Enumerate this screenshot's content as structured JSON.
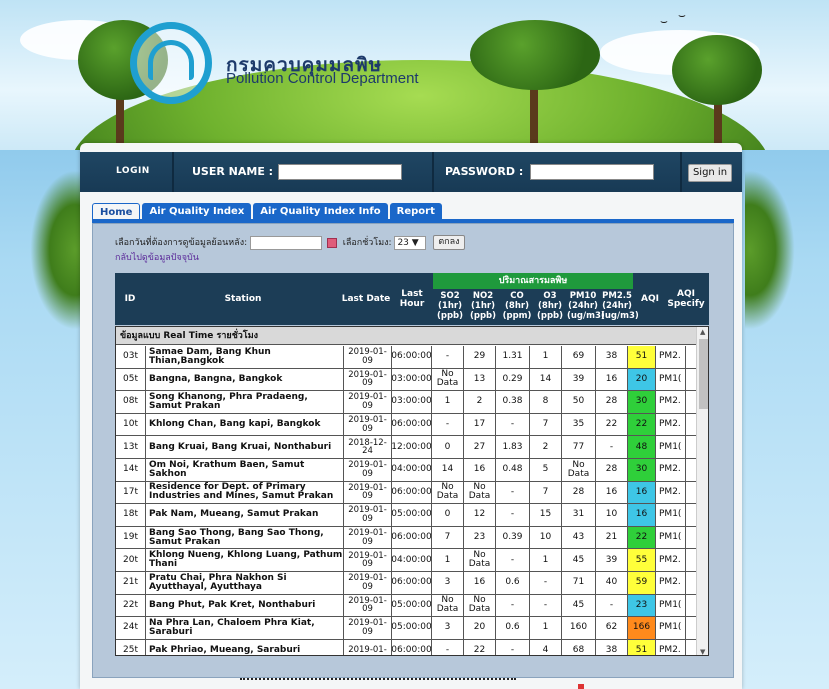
{
  "header": {
    "org_thai": "กรมควบคุมมลพิษ",
    "org_english": "Pollution Control Department"
  },
  "login": {
    "login_label": "LOGIN",
    "username_label": "USER NAME :",
    "username_value": "",
    "password_label": "PASSWORD :",
    "password_value": "",
    "signin_label": "Sign in"
  },
  "tabs": [
    {
      "label": "Home",
      "active": true
    },
    {
      "label": "Air Quality Index",
      "active": false
    },
    {
      "label": "Air Quality Index Info",
      "active": false
    },
    {
      "label": "Report",
      "active": false
    }
  ],
  "filter": {
    "date_label": "เลือกวันที่ต้องการดูข้อมูลย้อนหลัง:",
    "date_value": "",
    "hour_label": "เลือกชั่วโมง:",
    "hour_value": "23 ▼",
    "ok_label": "ตกลง",
    "back_link": "กลับไปดูข้อมูลปัจจุบัน"
  },
  "table": {
    "headers": {
      "id": "ID",
      "station": "Station",
      "last_date": "Last Date",
      "last_hour": "Last Hour",
      "pollutant_group": "ปริมาณสารมลพิษ",
      "so2": "SO2 (1hr) (ppb)",
      "no2": "NO2 (1hr) (ppb)",
      "co": "CO (8hr) (ppm)",
      "o3": "O3 (8hr) (ppb)",
      "pm10": "PM10 (24hr) (ug/m3)",
      "pm25": "PM2.5 (24hr) (ug/m3)",
      "aqi": "AQI",
      "aqi_specify": "AQI Specify"
    },
    "realtime_label": "ข้อมูลแบบ Real Time รายชั่วโมง",
    "aqi_colors": {
      "blue": "#3ec6e6",
      "green": "#2fcf3a",
      "yellow": "#ffff3a",
      "orange": "#ff8a1c"
    },
    "rows": [
      {
        "id": "03t",
        "station": "Samae Dam, Bang Khun Thian,Bangkok",
        "date": "2019-01-09",
        "hour": "06:00:00",
        "so2": "-",
        "no2": "29",
        "co": "1.31",
        "o3": "1",
        "pm10": "69",
        "pm25": "38",
        "aqi": "51",
        "aqi_color": "yellow",
        "spec": "PM2."
      },
      {
        "id": "05t",
        "station": "Bangna, Bangna, Bangkok",
        "date": "2019-01-09",
        "hour": "03:00:00",
        "so2": "No Data",
        "no2": "13",
        "co": "0.29",
        "o3": "14",
        "pm10": "39",
        "pm25": "16",
        "aqi": "20",
        "aqi_color": "blue",
        "spec": "PM1("
      },
      {
        "id": "08t",
        "station": "Song Khanong, Phra Pradaeng, Samut Prakan",
        "date": "2019-01-09",
        "hour": "03:00:00",
        "so2": "1",
        "no2": "2",
        "co": "0.38",
        "o3": "8",
        "pm10": "50",
        "pm25": "28",
        "aqi": "30",
        "aqi_color": "green",
        "spec": "PM2."
      },
      {
        "id": "10t",
        "station": "Khlong Chan, Bang kapi, Bangkok",
        "date": "2019-01-09",
        "hour": "06:00:00",
        "so2": "-",
        "no2": "17",
        "co": "-",
        "o3": "7",
        "pm10": "35",
        "pm25": "22",
        "aqi": "22",
        "aqi_color": "green",
        "spec": "PM2."
      },
      {
        "id": "13t",
        "station": "Bang Kruai, Bang Kruai, Nonthaburi",
        "date": "2018-12-24",
        "hour": "12:00:00",
        "so2": "0",
        "no2": "27",
        "co": "1.83",
        "o3": "2",
        "pm10": "77",
        "pm25": "-",
        "aqi": "48",
        "aqi_color": "green",
        "spec": "PM1("
      },
      {
        "id": "14t",
        "station": "Om Noi, Krathum Baen, Samut Sakhon",
        "date": "2019-01-09",
        "hour": "04:00:00",
        "so2": "14",
        "no2": "16",
        "co": "0.48",
        "o3": "5",
        "pm10": "No Data",
        "pm25": "28",
        "aqi": "30",
        "aqi_color": "green",
        "spec": "PM2."
      },
      {
        "id": "17t",
        "station": "Residence for Dept. of Primary Industries and Mines, Samut Prakan",
        "date": "2019-01-09",
        "hour": "06:00:00",
        "so2": "No Data",
        "no2": "No Data",
        "co": "-",
        "o3": "7",
        "pm10": "28",
        "pm25": "16",
        "aqi": "16",
        "aqi_color": "blue",
        "spec": "PM2."
      },
      {
        "id": "18t",
        "station": "Pak Nam, Mueang, Samut Prakan",
        "date": "2019-01-09",
        "hour": "05:00:00",
        "so2": "0",
        "no2": "12",
        "co": "-",
        "o3": "15",
        "pm10": "31",
        "pm25": "10",
        "aqi": "16",
        "aqi_color": "blue",
        "spec": "PM1("
      },
      {
        "id": "19t",
        "station": "Bang Sao Thong, Bang Sao Thong, Samut Prakan",
        "date": "2019-01-09",
        "hour": "06:00:00",
        "so2": "7",
        "no2": "23",
        "co": "0.39",
        "o3": "10",
        "pm10": "43",
        "pm25": "21",
        "aqi": "22",
        "aqi_color": "green",
        "spec": "PM1("
      },
      {
        "id": "20t",
        "station": "Khlong Nueng, Khlong Luang, Pathum Thani",
        "date": "2019-01-09",
        "hour": "04:00:00",
        "so2": "1",
        "no2": "No Data",
        "co": "-",
        "o3": "1",
        "pm10": "45",
        "pm25": "39",
        "aqi": "55",
        "aqi_color": "yellow",
        "spec": "PM2."
      },
      {
        "id": "21t",
        "station": "Pratu Chai, Phra Nakhon Si Ayutthayal, Ayutthaya",
        "date": "2019-01-09",
        "hour": "06:00:00",
        "so2": "3",
        "no2": "16",
        "co": "0.6",
        "o3": "-",
        "pm10": "71",
        "pm25": "40",
        "aqi": "59",
        "aqi_color": "yellow",
        "spec": "PM2."
      },
      {
        "id": "22t",
        "station": "Bang Phut, Pak Kret, Nonthaburi",
        "date": "2019-01-09",
        "hour": "05:00:00",
        "so2": "No Data",
        "no2": "No Data",
        "co": "-",
        "o3": "-",
        "pm10": "45",
        "pm25": "-",
        "aqi": "23",
        "aqi_color": "blue",
        "spec": "PM1("
      },
      {
        "id": "24t",
        "station": "Na Phra Lan, Chaloem Phra Kiat, Saraburi",
        "date": "2019-01-09",
        "hour": "05:00:00",
        "so2": "3",
        "no2": "20",
        "co": "0.6",
        "o3": "1",
        "pm10": "160",
        "pm25": "62",
        "aqi": "166",
        "aqi_color": "orange",
        "spec": "PM1("
      },
      {
        "id": "25t",
        "station": "Pak Phriao, Mueang, Saraburi",
        "date": "2019-01-",
        "hour": "06:00:00",
        "so2": "-",
        "no2": "22",
        "co": "-",
        "o3": "4",
        "pm10": "68",
        "pm25": "38",
        "aqi": "51",
        "aqi_color": "yellow",
        "spec": "PM2."
      }
    ]
  }
}
